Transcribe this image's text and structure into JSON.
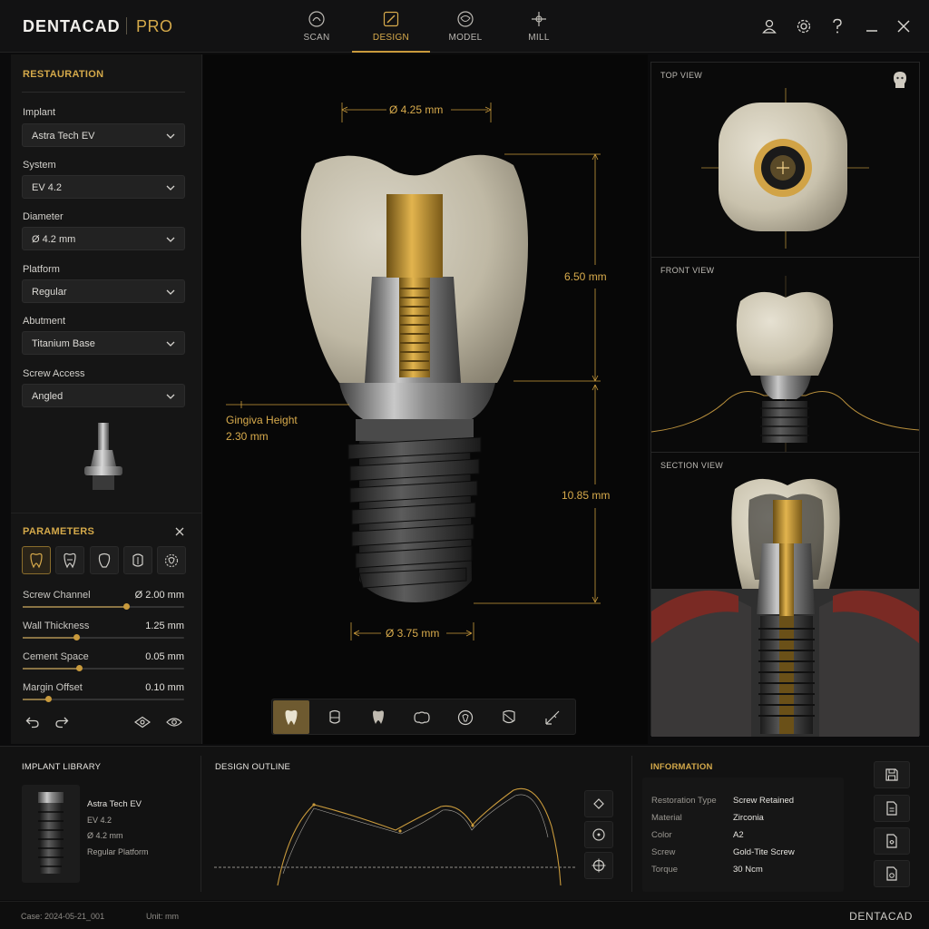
{
  "app": {
    "brand": "DENTACAD",
    "edition": "PRO"
  },
  "tabs": [
    {
      "label": "SCAN",
      "icon": "scan-icon",
      "active": false
    },
    {
      "label": "DESIGN",
      "icon": "design-icon",
      "active": true
    },
    {
      "label": "MODEL",
      "icon": "model-icon",
      "active": false
    },
    {
      "label": "MILL",
      "icon": "mill-icon",
      "active": false
    }
  ],
  "top_actions": [
    "user-icon",
    "settings-icon",
    "help-icon",
    "minimize-icon",
    "close-icon"
  ],
  "restoration": {
    "title": "RESTAURATION",
    "fields": [
      {
        "label": "Implant",
        "value": "Astra Tech EV"
      },
      {
        "label": "System",
        "value": "EV 4.2"
      },
      {
        "label": "Diameter",
        "value": "Ø 4.2 mm"
      },
      {
        "label": "Platform",
        "value": "Regular"
      },
      {
        "label": "Abutment",
        "value": "Titanium Base"
      },
      {
        "label": "Screw Access",
        "value": "Angled"
      }
    ]
  },
  "parameters": {
    "title": "PARAMETERS",
    "tools": [
      "crown-tool-icon",
      "tooth-outline-icon",
      "tooth-side-icon",
      "tooth-section-icon",
      "tooth-rotate-icon"
    ],
    "rows": [
      {
        "label": "Screw Channel",
        "value": "Ø 2.00 mm",
        "level": 0.64
      },
      {
        "label": "Wall Thickness",
        "value": "1.25 mm",
        "level": 0.33
      },
      {
        "label": "Cement Space",
        "value": "0.05 mm",
        "level": 0.35
      },
      {
        "label": "Margin Offset",
        "value": "0.10 mm",
        "level": 0.16
      }
    ]
  },
  "viewport": {
    "dims": {
      "top_diameter": "Ø 4.25 mm",
      "crown_height": "6.50 mm",
      "gingiva_label": "Gingiva Height",
      "gingiva_value": "2.30 mm",
      "implant_length": "10.85 mm",
      "bottom_diameter": "Ø 3.75 mm"
    },
    "toolbar": [
      "crown-view-icon",
      "abutment-view-icon",
      "tooth-view-icon",
      "occlusal-view-icon",
      "implant-view-icon",
      "section-view-icon",
      "measure-icon"
    ]
  },
  "views": {
    "top": "TOP VIEW",
    "front": "FRONT VIEW",
    "section": "SECTION VIEW"
  },
  "library": {
    "title": "IMPLANT LIBRARY",
    "name": "Astra Tech EV",
    "system": "EV 4.2",
    "diameter": "Ø 4.2 mm",
    "platform": "Regular Platform"
  },
  "outline": {
    "title": "DESIGN OUTLINE",
    "tools": [
      "outline-rotate-icon",
      "outline-center-icon",
      "outline-target-icon"
    ]
  },
  "information": {
    "title": "INFORMATION",
    "rows": [
      {
        "key": "Restoration Type",
        "value": "Screw Retained"
      },
      {
        "key": "Material",
        "value": "Zirconia"
      },
      {
        "key": "Color",
        "value": "A2"
      },
      {
        "key": "Screw",
        "value": "Gold-Tite Screw"
      },
      {
        "key": "Torque",
        "value": "30 Ncm"
      }
    ]
  },
  "actions": [
    "save-icon",
    "document-icon",
    "export-file-icon",
    "image-file-icon"
  ],
  "status": {
    "case": "Case: 2024-05-21_001",
    "unit": "Unit: mm",
    "brand": "DENTACAD"
  },
  "colors": {
    "accent": "#d4a94a",
    "background": "#0b0b0c",
    "panel": "#151515"
  }
}
